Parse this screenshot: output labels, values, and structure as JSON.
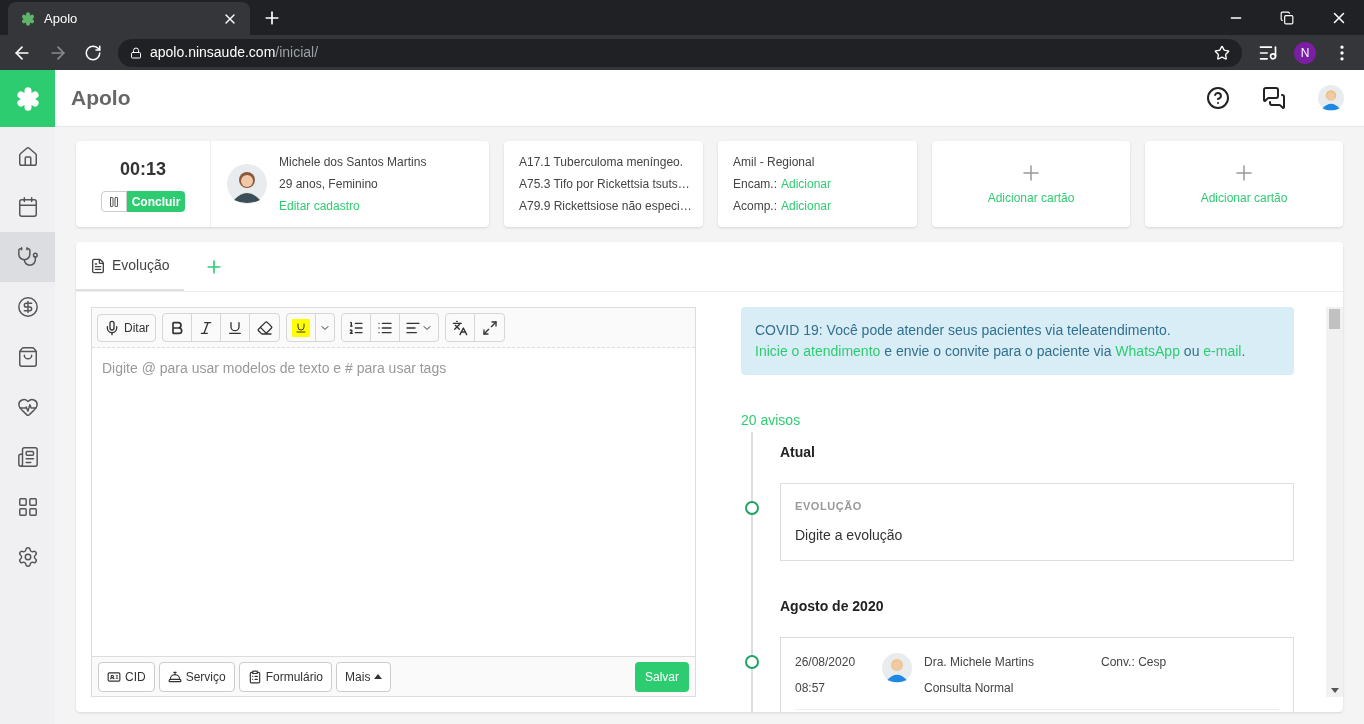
{
  "browser": {
    "tab_title": "Apolo",
    "url_host": "apolo.ninsaude.com",
    "url_path": "/inicial/",
    "profile_initial": "N"
  },
  "app": {
    "title": "Apolo"
  },
  "sidebar": {
    "items": [
      {
        "kind": "home",
        "selected": false
      },
      {
        "kind": "calendar",
        "selected": false
      },
      {
        "kind": "stethoscope",
        "selected": true
      },
      {
        "kind": "money",
        "selected": false
      },
      {
        "kind": "bag",
        "selected": false
      },
      {
        "kind": "heart",
        "selected": false
      },
      {
        "kind": "report",
        "selected": false
      },
      {
        "kind": "grid",
        "selected": false
      },
      {
        "kind": "settings",
        "selected": false
      }
    ]
  },
  "timer": {
    "time": "00:13",
    "finish": "Concluir"
  },
  "patient": {
    "name": "Michele dos Santos Martins",
    "info": "29 anos, Feminino",
    "edit": "Editar cadastro"
  },
  "diagnoses": [
    "A17.1 Tuberculoma meníngeo.",
    "A75.3 Tifo por Rickettsia tsuts…",
    "A79.9 Rickettsiose não especi…"
  ],
  "insurance": {
    "name": "Amil - Regional",
    "lines": [
      {
        "label": "Encam.:",
        "link": "Adicionar"
      },
      {
        "label": "Acomp.:",
        "link": "Adicionar"
      }
    ]
  },
  "add_cards": [
    {
      "label": "Adicionar cartão"
    },
    {
      "label": "Adicionar cartão"
    }
  ],
  "tabs": [
    {
      "label": "Evolução",
      "selected": true
    }
  ],
  "editor": {
    "dictate": "Ditar",
    "placeholder": "Digite @ para usar modelos de texto e # para usar tags",
    "footer": [
      {
        "kind": "cid",
        "label": "CID"
      },
      {
        "kind": "service",
        "label": "Serviço"
      },
      {
        "kind": "form",
        "label": "Formulário"
      },
      {
        "kind": "more",
        "label": "Mais"
      }
    ],
    "save": "Salvar"
  },
  "notice": [
    {
      "text": "COVID 19: Você pode atender seus pacientes via teleatendimento. ",
      "link": false
    },
    {
      "text": "Inicie o atendimento",
      "link": true
    },
    {
      "text": " e envie o convite para o paciente via ",
      "link": false
    },
    {
      "text": "WhatsApp",
      "link": true
    },
    {
      "text": " ou ",
      "link": false
    },
    {
      "text": "e-mail",
      "link": true
    },
    {
      "text": ".",
      "link": false
    }
  ],
  "timeline": {
    "count": "20 avisos",
    "groups": [
      {
        "title": "Atual",
        "entries": [
          {
            "kind": "draft",
            "label": "EVOLUÇÃO",
            "text": "Digite a evolução"
          }
        ]
      },
      {
        "title": "Agosto de 2020",
        "entries": [
          {
            "kind": "visit",
            "date": "26/08/2020",
            "time": "08:57",
            "doctor": "Dra. Michele Martins",
            "type": "Consulta Normal",
            "conv": "Conv.: Cesp"
          }
        ]
      }
    ]
  }
}
